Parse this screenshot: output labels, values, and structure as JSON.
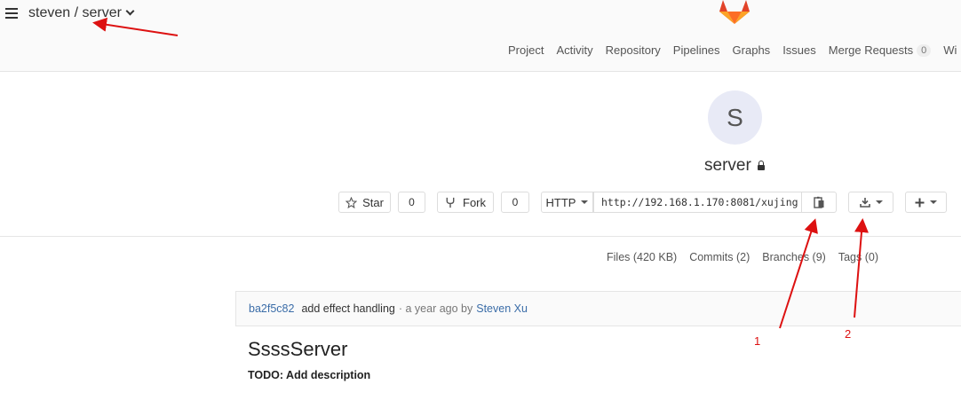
{
  "header": {
    "breadcrumb": "steven / server",
    "nav": [
      {
        "label": "Project"
      },
      {
        "label": "Activity"
      },
      {
        "label": "Repository"
      },
      {
        "label": "Pipelines"
      },
      {
        "label": "Graphs"
      },
      {
        "label": "Issues"
      },
      {
        "label": "Merge Requests",
        "count": "0"
      },
      {
        "label": "Wi"
      }
    ]
  },
  "project": {
    "avatar_letter": "S",
    "name": "server",
    "star_label": "Star",
    "star_count": "0",
    "fork_label": "Fork",
    "fork_count": "0",
    "protocol": "HTTP",
    "clone_url": "http://192.168.1.170:8081/xujing"
  },
  "stats": [
    {
      "label": "Files (420 KB)"
    },
    {
      "label": "Commits (2)"
    },
    {
      "label": "Branches (9)"
    },
    {
      "label": "Tags (0)"
    }
  ],
  "last_commit": {
    "sha": "ba2f5c82",
    "message": "add effect handling",
    "meta": "· a year ago by",
    "author": "Steven Xu"
  },
  "readme": {
    "title": "SsssServer",
    "body": "TODO: Add description"
  },
  "annotations": {
    "label_1": "1",
    "label_2": "2",
    "arrow_color": "#d11"
  },
  "icons": {
    "menu": "hamburger-icon",
    "star": "star-icon",
    "fork": "fork-icon",
    "copy": "clipboard-icon",
    "download": "download-icon",
    "add": "plus-icon",
    "privacy": "lock-icon"
  }
}
